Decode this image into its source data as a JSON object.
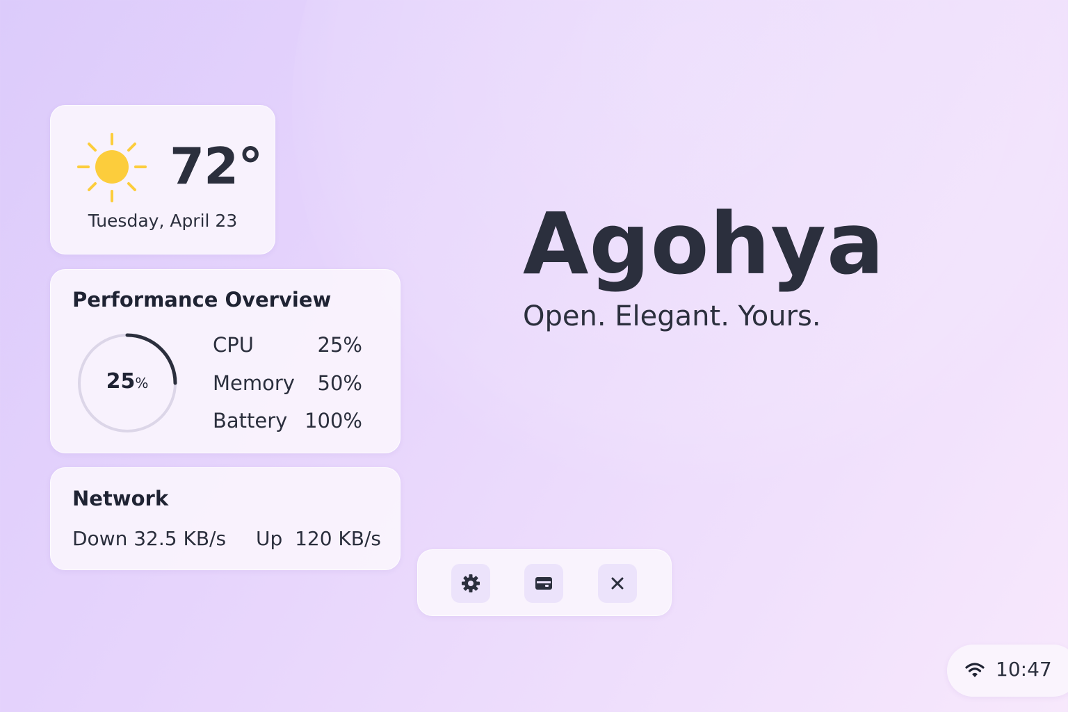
{
  "weather": {
    "icon": "sun-icon",
    "temperature": "72°",
    "date": "Tuesday, April 23"
  },
  "performance": {
    "title": "Performance Overview",
    "gauge_value": "25",
    "gauge_unit": "%",
    "gauge_fraction": 0.25,
    "stats": [
      {
        "label": "CPU",
        "value": "25%"
      },
      {
        "label": "Memory",
        "value": "50%"
      },
      {
        "label": "Battery",
        "value": "100%"
      }
    ]
  },
  "network": {
    "title": "Network",
    "down": "Down 32.5 KB/s",
    "up": "Up  120 KB/s"
  },
  "hero": {
    "brand": "Agohya",
    "tagline": "Open. Elegant. Yours."
  },
  "dock": {
    "buttons": [
      {
        "icon": "gear-icon"
      },
      {
        "icon": "wallet-icon"
      },
      {
        "icon": "close-icon"
      }
    ]
  },
  "status": {
    "wifi_icon": "wifi-icon",
    "time": "10:47"
  },
  "colors": {
    "sun": "#fccd3c",
    "text": "#2b2f3d",
    "gauge_track": "#dcd6e8",
    "gauge_fill": "#2b2f3d"
  }
}
